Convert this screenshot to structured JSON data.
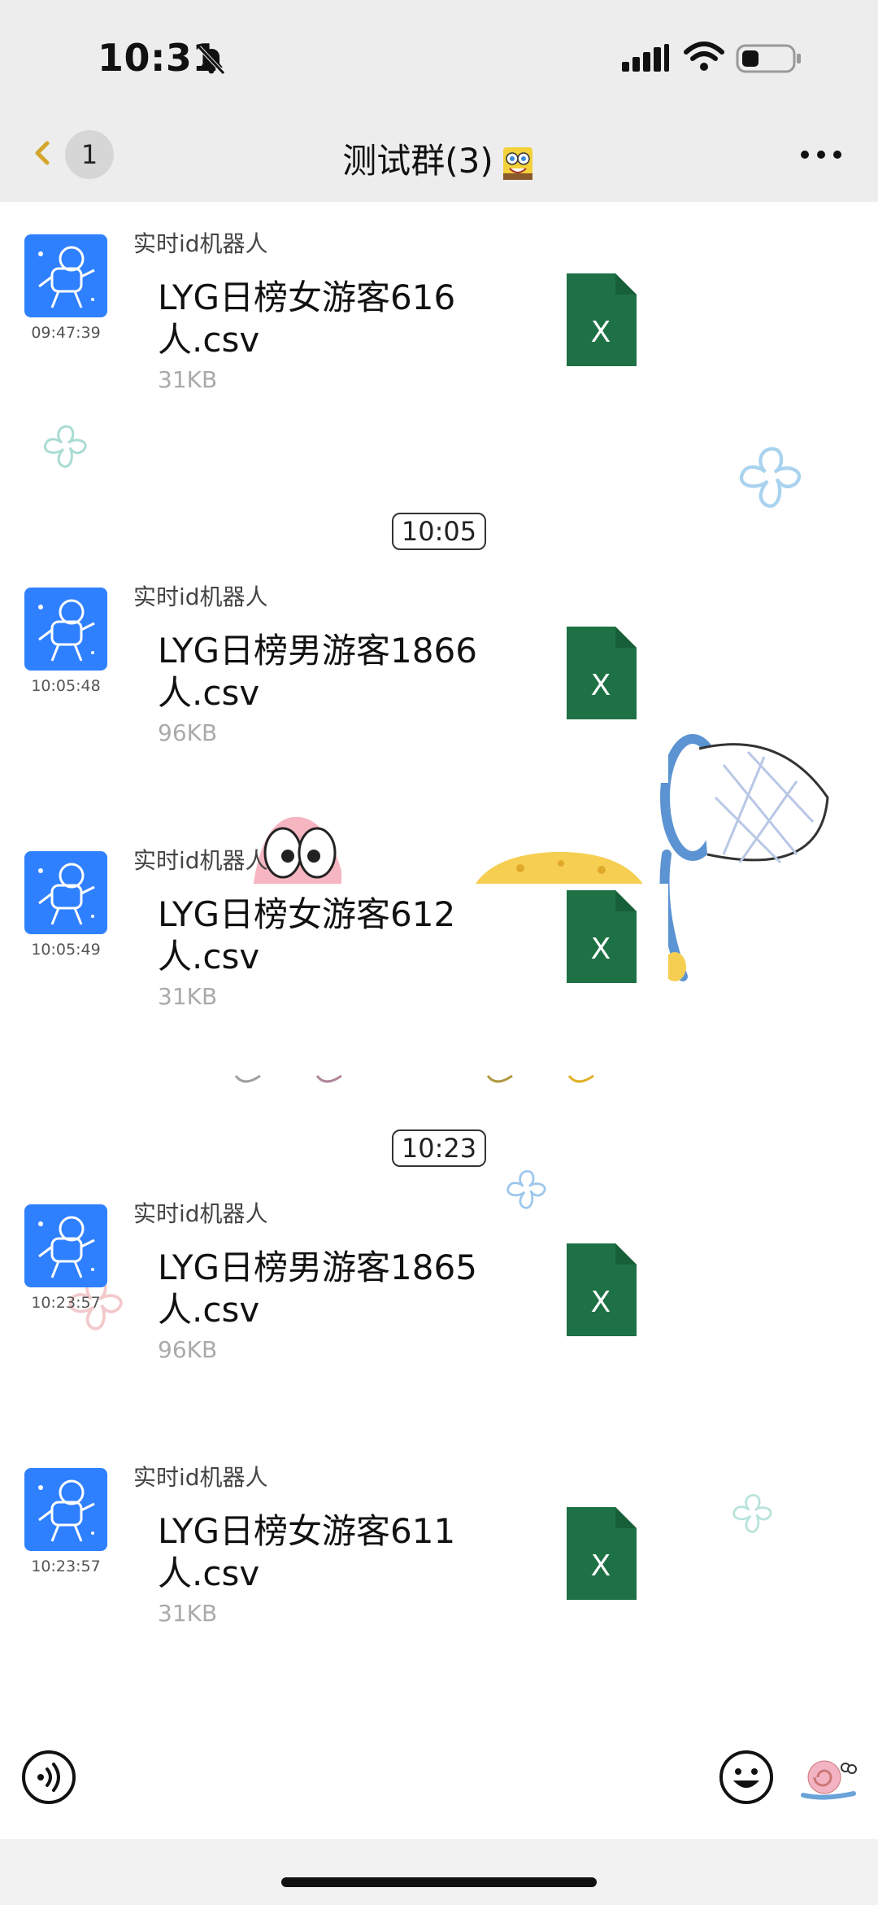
{
  "status_bar": {
    "time": "10:31"
  },
  "header": {
    "unread_count": "1",
    "title": "测试群(3)"
  },
  "messages": [
    {
      "type": "file",
      "sender": "实时id机器人",
      "time": "09:47:39",
      "file_name": "LYG日榜女游客616人.csv",
      "file_size": "31KB"
    },
    {
      "type": "time_separator",
      "label": "10:05"
    },
    {
      "type": "file",
      "sender": "实时id机器人",
      "time": "10:05:48",
      "file_name": "LYG日榜男游客1866人.csv",
      "file_size": "96KB"
    },
    {
      "type": "file",
      "sender": "实时id机器人",
      "time": "10:05:49",
      "file_name": "LYG日榜女游客612人.csv",
      "file_size": "31KB"
    },
    {
      "type": "time_separator",
      "label": "10:23"
    },
    {
      "type": "file",
      "sender": "实时id机器人",
      "time": "10:23:57",
      "file_name": "LYG日榜男游客1865人.csv",
      "file_size": "96KB"
    },
    {
      "type": "file",
      "sender": "实时id机器人",
      "time": "10:23:57",
      "file_name": "LYG日榜女游客611人.csv",
      "file_size": "31KB"
    }
  ],
  "icons": {
    "file": "excel-file-icon",
    "voice": "voice-input-icon",
    "emoji": "emoji-icon",
    "more": "more-options-icon",
    "back": "back-chevron-icon"
  },
  "colors": {
    "avatar": "#2f80ff",
    "excel": "#1e7145",
    "header_bg": "#ededed"
  }
}
